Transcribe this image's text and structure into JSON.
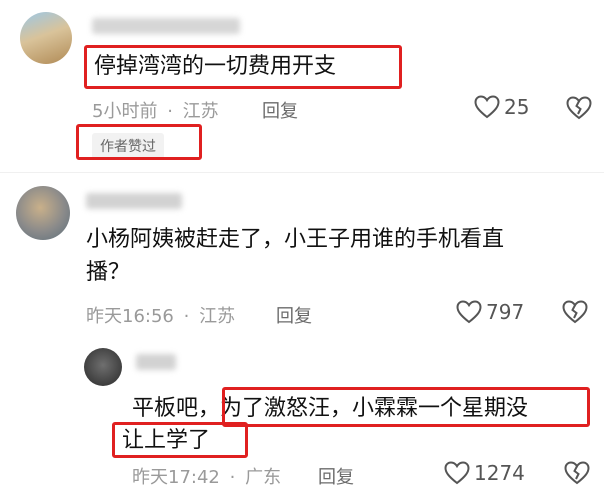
{
  "comments": [
    {
      "text": "停掉湾湾的一切费用开支",
      "time": "5小时前",
      "separator": "·",
      "location": "江苏",
      "reply_label": "回复",
      "likes": "25",
      "badge": "作者赞过"
    },
    {
      "text_line1": "小杨阿姨被赶走了，小王子用谁的手机看直",
      "text_line2": "播？",
      "time": "昨天16:56",
      "separator": "·",
      "location": "江苏",
      "reply_label": "回复",
      "likes": "797"
    },
    {
      "text_line1": "平板吧，为了激怒汪，小霖霖一个星期没",
      "text_line2": "让上学了",
      "time": "昨天17:42",
      "separator": "·",
      "location": "广东",
      "reply_label": "回复",
      "likes": "1274"
    }
  ],
  "colors": {
    "highlight_box": "#e02020",
    "meta_text": "#9a9a9a",
    "badge_bg": "#f2f2f2"
  }
}
